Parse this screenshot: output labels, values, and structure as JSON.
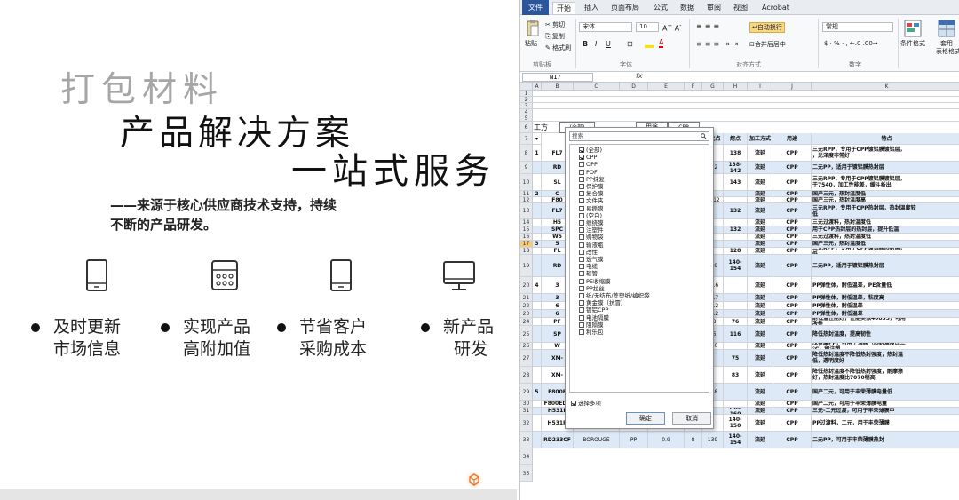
{
  "slide": {
    "title_line1": "打包材料",
    "title_line2": "产品解决方案",
    "title_line3": "一站式服务",
    "subtitle_line1": "——来源于核心供应商技术支持，持续",
    "subtitle_line2": "不断的产品研发。",
    "features": [
      {
        "icon": "tablet-icon",
        "line1": "及时更新",
        "line2": "市场信息"
      },
      {
        "icon": "calculator-icon",
        "line1": "实现产品",
        "line2": "高附加值"
      },
      {
        "icon": "tablet-icon",
        "line1": "节省客户",
        "line2": "采购成本"
      },
      {
        "icon": "monitor-icon",
        "line1": "新产品",
        "line2": "研发"
      }
    ]
  },
  "excel": {
    "tabs": [
      "文件",
      "开始",
      "插入",
      "页面布局",
      "公式",
      "数据",
      "审阅",
      "视图",
      "Acrobat"
    ],
    "active_tab": "开始",
    "ribbon": {
      "cut": "剪切",
      "copy": "复制",
      "format_painter": "格式刷",
      "paste": "粘贴",
      "font_name": "宋体",
      "font_size": "10",
      "wrap_text": "自动换行",
      "merge_center": "合并后居中",
      "number_format": "常规",
      "conditional_format": "条件格式",
      "table_format": "套用",
      "table_format_sub": "表格格式",
      "groups": [
        "剪贴板",
        "字体",
        "对齐方式",
        "数字"
      ]
    },
    "name_box": "N17",
    "fx": "fx",
    "columns": [
      "A",
      "B",
      "C",
      "D",
      "E",
      "F",
      "G",
      "H",
      "I",
      "J",
      "K"
    ],
    "row_numbers": [
      "1",
      "2",
      "3",
      "4",
      "5",
      "6",
      "7",
      "8",
      "9",
      "10",
      "11",
      "12",
      "13",
      "14",
      "15",
      "16",
      "17",
      "18",
      "19",
      "20",
      "21",
      "22",
      "23",
      "24",
      "25",
      "26",
      "27",
      "28",
      "29",
      "30",
      "31",
      "32",
      "33",
      "34",
      "35"
    ],
    "selected_row": "17",
    "filter_row": {
      "label_process": "工方",
      "process_value": "(全部)",
      "label_use": "用途",
      "use_value": "CPP"
    },
    "headers": {
      "soften": "软化点",
      "melt": "熔点",
      "process": "加工方式",
      "use": "用途",
      "feature": "特点"
    },
    "rows": [
      {
        "a": "1",
        "b": "FL7",
        "c": "",
        "d": "",
        "e": "",
        "f": "",
        "g": "",
        "h": "138",
        "i": "流延",
        "j": "CPP",
        "k": "三元RPP，专用于CPP镀铝膜镀铝层，\n，光泽度非常好"
      },
      {
        "a": "",
        "b": "RD",
        "c": "",
        "d": "",
        "e": "",
        "f": "",
        "g": "122",
        "h": "138-\n142",
        "i": "流延",
        "j": "CPP",
        "k": "二元PP，适用于镀铝膜热封层"
      },
      {
        "a": "",
        "b": "SL",
        "c": "",
        "d": "",
        "e": "",
        "f": "",
        "g": "",
        "h": "143",
        "i": "流延",
        "j": "CPP",
        "k": "三元RPP，专用于CPP镀铝膜镀铝层，\n于7540，加工性能差，缓斗析出"
      },
      {
        "a": "2",
        "b": "C",
        "c": "",
        "d": "",
        "e": "",
        "f": "",
        "g": "",
        "h": "",
        "i": "流延",
        "j": "CPP",
        "k": "国产三元，热封温度低"
      },
      {
        "a": "",
        "b": "F80",
        "c": "",
        "d": "",
        "e": "",
        "f": "",
        "g": ">112",
        "h": "",
        "i": "流延",
        "j": "CPP",
        "k": "国产三元，热封温度高"
      },
      {
        "a": "",
        "b": "FL7",
        "c": "",
        "d": "",
        "e": "",
        "f": "",
        "g": "",
        "h": "132",
        "i": "流延",
        "j": "CPP",
        "k": "三元RPP，专用于CPP热封层，热封温度较\n低"
      },
      {
        "a": "",
        "b": "H5",
        "c": "",
        "d": "",
        "e": "",
        "f": "7",
        "g": "",
        "h": "",
        "i": "流延",
        "j": "CPP",
        "k": "三元过渡料，热封温度低"
      },
      {
        "a": "",
        "b": "SPC",
        "c": "",
        "d": "",
        "e": "",
        "f": "",
        "g": "",
        "h": "132",
        "i": "流延",
        "j": "CPP",
        "k": "用于CPP热封层的热封层，提升低温"
      },
      {
        "a": "",
        "b": "W5",
        "c": "",
        "d": "",
        "e": "",
        "f": "0",
        "g": "",
        "h": "",
        "i": "流延",
        "j": "CPP",
        "k": "三元过渡料，热封温度低"
      },
      {
        "a": "3",
        "b": "5",
        "c": "",
        "d": "",
        "e": "",
        "f": "",
        "g": "",
        "h": "",
        "i": "流延",
        "j": "CPP",
        "k": "国产三元，热封温度低"
      },
      {
        "a": "",
        "b": "FL",
        "c": "",
        "d": "",
        "e": "",
        "f": "",
        "g": "",
        "h": "128",
        "i": "流延",
        "j": "CPP",
        "k": "三元RPP，专用于CPP镀铝膜热封层，\n低"
      },
      {
        "a": "",
        "b": "RD",
        "c": "",
        "d": "",
        "e": "",
        "f": "",
        "g": "139",
        "h": "140-\n154",
        "i": "流延",
        "j": "CPP",
        "k": "二元PP，适用于镀铝膜热封层"
      },
      {
        "a": "4",
        "b": "3",
        "c": "",
        "d": "",
        "e": "",
        "f": "5",
        "g": "65.6",
        "h": "",
        "i": "流延",
        "j": "CPP",
        "k": "PP弹性体，耐低温差，PE含量低"
      },
      {
        "a": "",
        "b": "3",
        "c": "",
        "d": "",
        "e": "",
        "f": "7",
        "g": "76.7",
        "h": "",
        "i": "流延",
        "j": "CPP",
        "k": "PP弹性体，耐低温差，粘度高"
      },
      {
        "a": "",
        "b": "6",
        "c": "",
        "d": "",
        "e": "",
        "f": "4",
        "g": "52.2",
        "h": "",
        "i": "流延",
        "j": "CPP",
        "k": "PP弹性体，耐低温差"
      },
      {
        "a": "",
        "b": "6",
        "c": "",
        "d": "",
        "e": "",
        "f": "1",
        "g": "47.2",
        "h": "",
        "i": "流延",
        "j": "CPP",
        "k": "PP弹性体，耐低温差"
      },
      {
        "a": "",
        "b": "PF",
        "c": "",
        "d": "",
        "e": "",
        "f": "5",
        "g": "48",
        "h": "76",
        "i": "流延",
        "j": "CPP",
        "k": "耐低温性能好，性能类似40855，可用\n改性"
      },
      {
        "a": "",
        "b": "SP",
        "c": "",
        "d": "",
        "e": "",
        "f": "",
        "g": "96",
        "h": "116",
        "i": "流延",
        "j": "CPP",
        "k": "降低热封温度，提高韧性"
      },
      {
        "a": "",
        "b": "W",
        "c": "",
        "d": "",
        "e": "",
        "f": "",
        "g": "110",
        "h": "",
        "i": "流延",
        "j": "CPP",
        "k": "茂金属PP，可用于薄膜（热封温度比三\n℃）和注塑"
      },
      {
        "a": "",
        "b": "XM-",
        "c": "",
        "d": "",
        "e": "",
        "f": "",
        "g": "",
        "h": "75",
        "i": "流延",
        "j": "CPP",
        "k": "降低热封温度不降低热封强度，热封温\n低，透明度好"
      },
      {
        "a": "",
        "b": "XM-",
        "c": "",
        "d": "",
        "e": "",
        "f": "",
        "g": "",
        "h": "83",
        "i": "流延",
        "j": "CPP",
        "k": "降低热封温度不降低热封强度，耐摩擦\n好，热封温度比7070稍高"
      },
      {
        "a": "5",
        "b": "F800E",
        "c": "上海石化",
        "d": "PP",
        "e": "0.9",
        "f": "8",
        "g": "128",
        "h": "",
        "i": "流延",
        "j": "CPP",
        "k": "国产二元，可用于丰荣薄膜电量低"
      },
      {
        "a": "",
        "b": "F800EDF",
        "c": "上海石化",
        "d": "PP",
        "e": "0.9",
        "f": "8",
        "g": "",
        "h": "",
        "i": "流延",
        "j": "CPP",
        "k": "国产二元，可用于丰荣薄膜电量"
      },
      {
        "a": "",
        "b": "H531L",
        "c": "TPC",
        "d": "PP",
        "e": "0.89-\n0.91",
        "f": "3~7",
        "g": "",
        "h": "130-\n160",
        "i": "流延",
        "j": "CPP",
        "k": "三元-二元过渡，可用于丰荣薄膜中"
      },
      {
        "a": "",
        "b": "H531P",
        "c": "TPC",
        "d": "PP",
        "e": "0.9",
        "f": "5~7",
        "g": "",
        "h": "140-\n150",
        "i": "流延",
        "j": "CPP",
        "k": "PP过渡料，二元，用于丰荣薄膜"
      },
      {
        "a": "",
        "b": "RD233CF",
        "c": "BOROUGE",
        "d": "PP",
        "e": "0.9",
        "f": "8",
        "g": "139",
        "h": "140-\n154",
        "i": "流延",
        "j": "CPP",
        "k": "二元PP，可用于丰荣薄膜热封"
      }
    ],
    "filter_popup": {
      "search_placeholder": "搜索",
      "items": [
        {
          "label": "(全部)",
          "checked": true
        },
        {
          "label": "CPP",
          "checked": true
        },
        {
          "label": "OPP",
          "checked": false
        },
        {
          "label": "POF",
          "checked": false
        },
        {
          "label": "PP抹复",
          "checked": false
        },
        {
          "label": "保护膜",
          "checked": false
        },
        {
          "label": "复合膜",
          "checked": false
        },
        {
          "label": "文件夹",
          "checked": false
        },
        {
          "label": "易撕膜",
          "checked": false
        },
        {
          "label": "(空白)",
          "checked": false
        },
        {
          "label": "缠绕膜",
          "checked": false
        },
        {
          "label": "注塑件",
          "checked": false
        },
        {
          "label": "购物袋",
          "checked": false
        },
        {
          "label": "输液瓶",
          "checked": false
        },
        {
          "label": "改性",
          "checked": false
        },
        {
          "label": "透气膜",
          "checked": false
        },
        {
          "label": "电缆",
          "checked": false
        },
        {
          "label": "软管",
          "checked": false
        },
        {
          "label": "PE收缩膜",
          "checked": false
        },
        {
          "label": "PP拉丝",
          "checked": false
        },
        {
          "label": "纸/无纺布/蔗塑纸/编织袋",
          "checked": false
        },
        {
          "label": "黄金膜（抗冒）",
          "checked": false
        },
        {
          "label": "镀铝CPP",
          "checked": false
        },
        {
          "label": "电池隔膜",
          "checked": false
        },
        {
          "label": "阻隔膜",
          "checked": false
        },
        {
          "label": "利乐包",
          "checked": false
        }
      ],
      "multi_select": "选择多项",
      "ok": "确定",
      "cancel": "取消"
    }
  }
}
